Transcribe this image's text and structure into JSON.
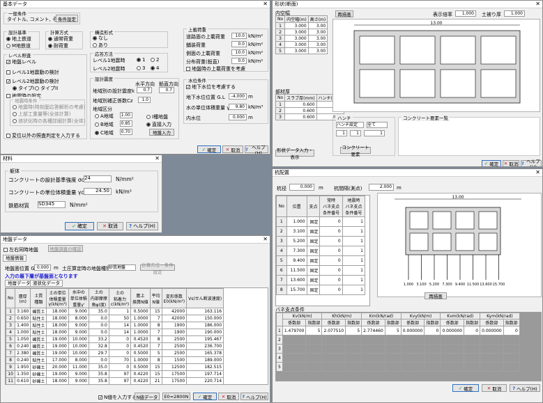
{
  "basic": {
    "title": "基本データ",
    "general_cond": "一般条件",
    "title_field": "タイトル, コメント, その他",
    "title_btn": "条件設定",
    "design_std": "設計基準",
    "std_opt1": "地上鉄道",
    "std_opt2": "M地鉄道",
    "calc_method": "計算方式",
    "calc_opt1": "通常荷重",
    "calc_opt2": "耐荷重",
    "span_cond": "構造形式",
    "span_opt1": "なし",
    "span_opt2": "あり",
    "level_head": "レベル照査",
    "ground_level": "地盤レベル",
    "level_chk1": "レベル1地震動の検討",
    "level_chk2": "レベル2地震動の検討",
    "type1": "タイプI",
    "type2": "タイプII",
    "eq_settings": "地震時の設定",
    "eq_sub": "地震時条件",
    "eq_item1": "地震時(時刻歴応答解析の考慮)",
    "eq_item2": "上部工重量等(全体計算)",
    "eq_item3": "液状化時の各種詳細計算(全体)",
    "disp_chk": "変位以外の照査判定を入力する",
    "seis_head": "応答方法",
    "lv1_label": "レベル1地震時",
    "lv2_label": "レベル2地震時",
    "r1": "1",
    "r2": "2",
    "r3": "3",
    "r4": "4",
    "kh_head": "設計震度",
    "col_h": "水平方向",
    "col_v": "鉛直方向",
    "kh_label": "地域別の設計震度k",
    "kh_h": "0.7",
    "kh_v": "0.7",
    "ratio_label": "地域別補正係数Cz",
    "ratio_val": "1.0",
    "region_head": "地域区分",
    "reg_a": "A地域",
    "reg_b": "B地域",
    "reg_c": "C地域",
    "reg_a_v": "1.00",
    "reg_b_v": "0.85",
    "reg_c_v": "0.70",
    "class_i": "I種地盤",
    "class_direct": "直接入力",
    "class_btn": "地盤入力",
    "load_head": "上載荷重",
    "load1": "道路面の上載荷重",
    "load1_v": "10.0",
    "load2": "舗装荷重",
    "load2_v": "0.0",
    "load3": "側面の上載荷重",
    "load3_v": "10.0",
    "load4": "分布荷重(鉛直)",
    "load4_v": "0.0",
    "load_chk": "地盤時の上載荷重を考慮",
    "unit_kn": "kN/m²",
    "water_head": "水位条件",
    "water_chk": "地下水位を考慮する",
    "water1": "地下水位位置 G.L",
    "water1_v": "-4.000",
    "water2": "水の単位体積重量 γw",
    "water2_v": "9.80",
    "water3": "内水位",
    "water3_v": "0.000",
    "unit_m": "m",
    "unit_kn3": "kN/m³",
    "ok": "確定",
    "cancel": "取消",
    "help": "ヘルプ(H)"
  },
  "shape": {
    "title": "形状(断面)",
    "inner_head": "内空幅",
    "grid_h1": "No",
    "grid_h2": "内空幅(m)",
    "grid_h3": "高さ(m)",
    "rows": [
      [
        "1",
        "3.000",
        "3.00"
      ],
      [
        "2",
        "3.000",
        "3.00"
      ],
      [
        "3",
        "3.000",
        "3.00"
      ],
      [
        "4",
        "3.000",
        "3.00"
      ],
      [
        "5",
        "3.000",
        "3.00"
      ]
    ],
    "thick_head": "部材厚",
    "th_h1": "No",
    "th_h2": "スラブ厚(mm)",
    "th_h3": "ハンチ(mm)",
    "th_rows": [
      [
        "1",
        "0.600",
        "0.60"
      ],
      [
        "2",
        "0.600",
        "0.60"
      ],
      [
        "3",
        "0.600",
        "0.60"
      ]
    ],
    "preview_btn": "再描画",
    "scale_label": "表示倍率",
    "scale_v": "1.000",
    "depth_label": "土被り厚",
    "depth_v": "1.000",
    "dim_total": "13.00",
    "haunch_head": "ハンチ",
    "sel1": "ハンチ設定",
    "sel2": "全て",
    "dist_head": "コンクリート要素",
    "dist_btn": "コンクリート要素",
    "list_head": "コンクリート要素一覧",
    "bottom_btn": "形状データ入力・表示",
    "ok": "確定",
    "cancel": "取消",
    "help": "ヘルプ(H)"
  },
  "material": {
    "title": "材料",
    "section": "躯体",
    "conc_label": "コンクリートの設計基準強度 σck",
    "conc_val": "24",
    "unit_nmm": "N/mm²",
    "unit_w_label": "コンクリートの単位体積重量 γc",
    "unit_w_val": "24.50",
    "unit_knm3": "kN/m³",
    "steel_label": "鉄筋材質",
    "steel_val": "SD345",
    "ok": "確定",
    "cancel": "取消",
    "help": "ヘルプ(H)"
  },
  "soil": {
    "title": "地盤データ",
    "left_chk": "左右同時地盤",
    "left_btn": "地盤調査の確認",
    "info_tab": "地盤情報",
    "gl_label": "地盤面位置 G.L",
    "gl_val": "0.000",
    "gl_unit": "m",
    "method_label": "土圧算定時の地盤種別",
    "method_val": "砂質地盤",
    "method_btn": "計算方法・条件設定",
    "warning": "入力の最下層が基盤面となります",
    "tab1": "地層データ",
    "tab2": "液状化データ",
    "headers": [
      "No",
      "層厚\n(m)",
      "土質\n種類",
      "土の単位\n体積重量\nγ(kN/m³)",
      "水中の\n単位体積\n重量γ'",
      "土の\n内部摩擦\n角φ(度)",
      "土の\n粘着力\nc(kN/m²)",
      "層上\n換算N値",
      "平均\nN値",
      "変形係数\nE0(kN/m²)",
      "Vs(せん断波速度)"
    ],
    "rows": [
      [
        "1",
        "3.160",
        "礫質土",
        "18.000",
        "9.000",
        "35.0",
        "1",
        "0.5000",
        "15",
        "42000",
        "163.116"
      ],
      [
        "2",
        "0.650",
        "粘性土",
        "18.000",
        "8.000",
        "0.0",
        "50",
        "1.0000",
        "7",
        "42000",
        "150.000"
      ],
      [
        "3",
        "1.400",
        "粘性土",
        "18.000",
        "9.000",
        "0.0",
        "14",
        "1.0000",
        "8",
        "1900",
        "186.000"
      ],
      [
        "4",
        "1.000",
        "粘性土",
        "18.000",
        "9.000",
        "0.0",
        "14",
        "1.0000",
        "7",
        "1900",
        "190.000"
      ],
      [
        "5",
        "1.050",
        "礫質土",
        "19.000",
        "10.000",
        "33.2",
        "0",
        "0.4520",
        "8",
        "2500",
        "195.467"
      ],
      [
        "6",
        "0.240",
        "礫質土",
        "19.000",
        "10.000",
        "32.8",
        "0",
        "0.4520",
        "7",
        "2500",
        "236.700"
      ],
      [
        "7",
        "2.380",
        "礫質土",
        "19.000",
        "10.000",
        "29.7",
        "0",
        "0.5000",
        "5",
        "2500",
        "165.378"
      ],
      [
        "8",
        "0.240",
        "粘性土",
        "17.000",
        "8.000",
        "0.0",
        "70",
        "1.0000",
        "8",
        "1500",
        "189.000"
      ],
      [
        "9",
        "1.950",
        "砂礫土",
        "20.000",
        "11.000",
        "35.0",
        "0",
        "0.5000",
        "15",
        "12500",
        "182.515"
      ],
      [
        "10",
        "1.350",
        "砂礫土",
        "19.000",
        "9.000",
        "35.8",
        "97",
        "0.4220",
        "15",
        "17500",
        "197.714"
      ],
      [
        "11",
        "0.610",
        "砂礫土",
        "18.000",
        "9.000",
        "35.8",
        "97",
        "0.4220",
        "21",
        "17500",
        "220.714"
      ],
      [
        "12",
        "",
        "",
        "",
        "",
        "",
        "",
        "",
        "",
        "",
        "",
        ""
      ]
    ],
    "footer_chk": "N値を入力する",
    "footer_btn1": "N値データ",
    "footer_btn2": "E0=2800N",
    "ok": "確定",
    "cancel": "取消",
    "help": "ヘルプ(H)"
  },
  "pile": {
    "title": "杭配置",
    "top_label": "杭径",
    "top_val": "0.000",
    "top_unit": "m",
    "dist_label": "杭間隔(測点)",
    "dist_val": "2.000",
    "dist_unit": "m",
    "headers": [
      "No",
      "位置",
      "支点",
      "常時\nバネ支点\n条件番号",
      "地震時\nバネ支点\n条件番号"
    ],
    "rows": [
      [
        "1",
        "1.000",
        "固定",
        "0",
        "1"
      ],
      [
        "2",
        "3.100",
        "固定",
        "0",
        "1"
      ],
      [
        "3",
        "5.200",
        "固定",
        "0",
        "1"
      ],
      [
        "4",
        "7.300",
        "固定",
        "0",
        "1"
      ],
      [
        "5",
        "9.400",
        "固定",
        "0",
        "1"
      ],
      [
        "6",
        "11.500",
        "固定",
        "0",
        "1"
      ],
      [
        "7",
        "13.600",
        "固定",
        "0",
        "1"
      ],
      [
        "8",
        "15.700",
        "固定",
        "0",
        "1"
      ]
    ],
    "redraw": "再描画",
    "dim_top": "13.00",
    "spring_head": "バネ支点条件",
    "spring_groups": [
      "Kv(kN/m)",
      "Kh(kN/m)",
      "Km(kN/rad)",
      "Kvy(kN/m)",
      "Kvm(kN/rad)",
      "Kym(kN/rad)"
    ],
    "sub_h1": "係数部",
    "sub_h2": "指数部",
    "spring_row": [
      "1",
      "1.479700",
      "5",
      "2.077510",
      "5",
      "2.774460",
      "5",
      "0.000000",
      "0",
      "0.000000",
      "0",
      "0.000000",
      "0"
    ],
    "ok": "確定",
    "cancel": "取消",
    "help": "ヘルプ(H)"
  }
}
